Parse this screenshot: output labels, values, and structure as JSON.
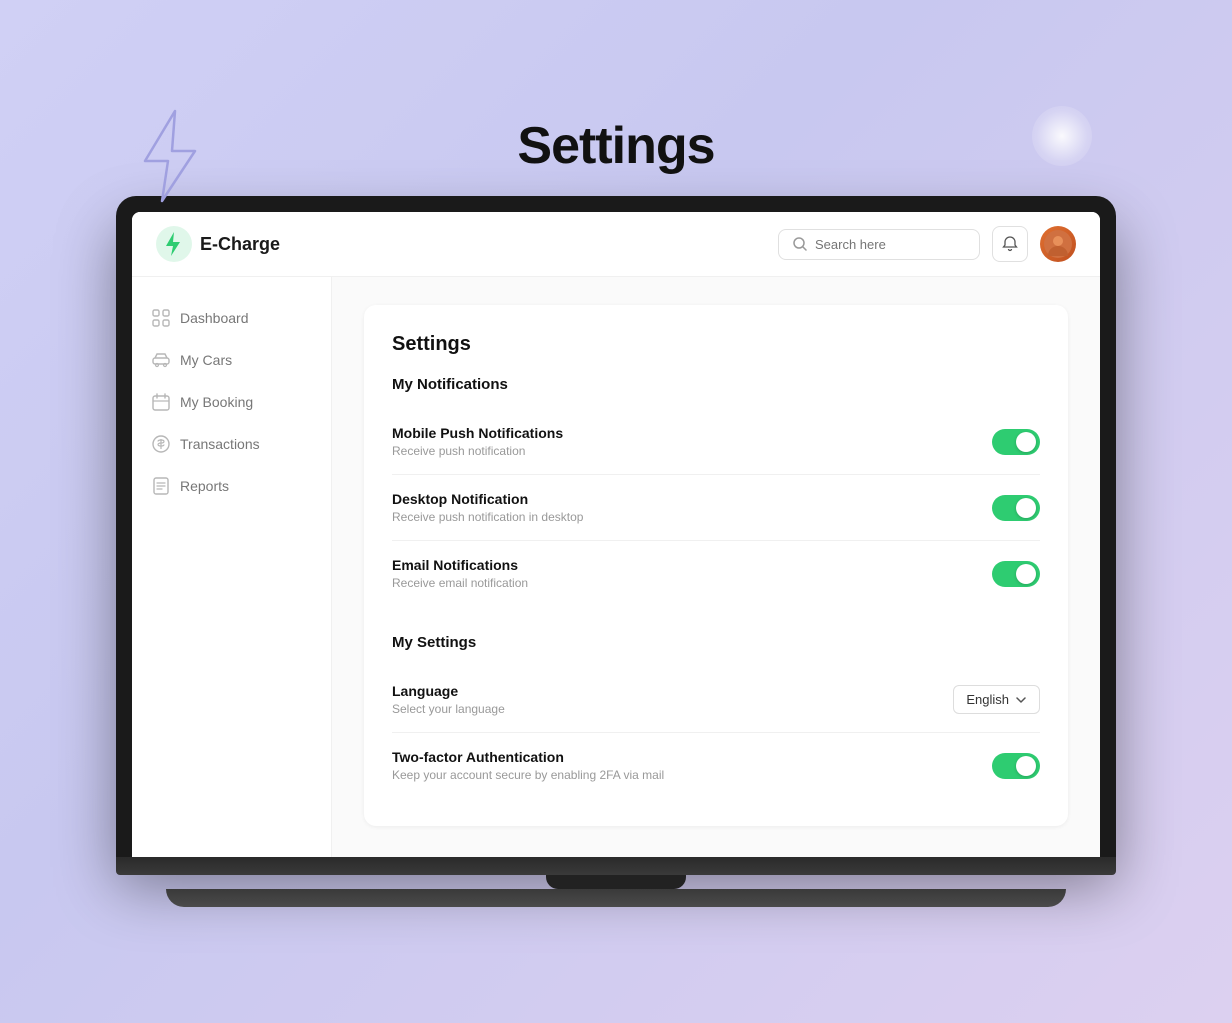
{
  "background_title": "Settings",
  "brand": {
    "name": "E-Charge",
    "logo_color": "#2ecc71"
  },
  "header": {
    "search_placeholder": "Search here",
    "notification_icon": "bell-icon",
    "avatar_icon": "user-avatar"
  },
  "sidebar": {
    "items": [
      {
        "id": "dashboard",
        "label": "Dashboard",
        "icon": "grid-icon"
      },
      {
        "id": "my-cars",
        "label": "My Cars",
        "icon": "car-icon"
      },
      {
        "id": "my-booking",
        "label": "My Booking",
        "icon": "calendar-icon"
      },
      {
        "id": "transactions",
        "label": "Transactions",
        "icon": "dollar-icon"
      },
      {
        "id": "reports",
        "label": "Reports",
        "icon": "file-icon"
      }
    ]
  },
  "main": {
    "page_title": "Settings",
    "notifications_section": {
      "title": "My Notifications",
      "items": [
        {
          "id": "mobile-push",
          "label": "Mobile Push Notifications",
          "description": "Receive push notification",
          "enabled": true
        },
        {
          "id": "desktop-notif",
          "label": "Desktop Notification",
          "description": "Receive push notification in desktop",
          "enabled": true
        },
        {
          "id": "email-notif",
          "label": "Email Notifications",
          "description": "Receive email notification",
          "enabled": true
        }
      ]
    },
    "settings_section": {
      "title": "My Settings",
      "language": {
        "label": "Language",
        "description": "Select your language",
        "value": "English"
      },
      "two_factor": {
        "label": "Two-factor Authentication",
        "description": "Keep your account secure by enabling 2FA via mail",
        "enabled": true
      }
    }
  }
}
